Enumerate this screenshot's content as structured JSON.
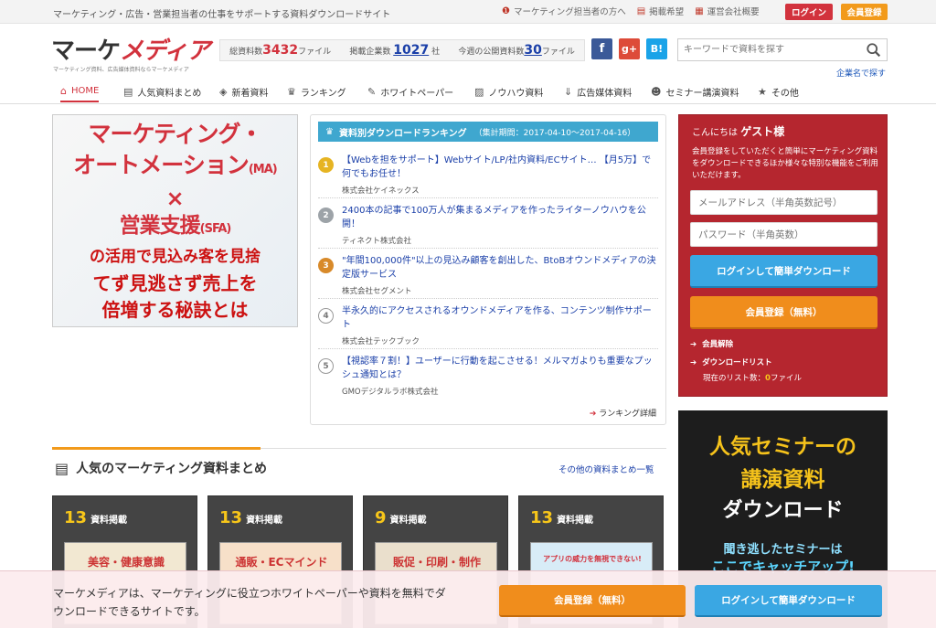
{
  "topbar": {
    "tagline": "マーケティング・広告・営業担当者の仕事をサポートする資料ダウンロードサイト",
    "links": [
      "マーケティング担当者の方へ",
      "掲載希望",
      "運営会社概要"
    ],
    "login": "ログイン",
    "register": "会員登録"
  },
  "header": {
    "logo_plain": "マーケ",
    "logo_em": "メディア",
    "logo_sub": "マーケティング資料、広告媒体資料ならマーケメディア",
    "stats": {
      "total_label": "総資料数",
      "total_value": "3432",
      "total_unit": "ファイル",
      "companies_label": "掲載企業数",
      "companies_value": "1027",
      "companies_unit": "社",
      "weekly_label": "今週の公開資料数",
      "weekly_value": "30",
      "weekly_unit": "ファイル"
    },
    "social": {
      "facebook": "f",
      "google": "g+",
      "hatena": "B!"
    },
    "search_placeholder": "キーワードで資料を探す",
    "company_search": "企業名で探す"
  },
  "nav": [
    "HOME",
    "人気資料まとめ",
    "新着資料",
    "ランキング",
    "ホワイトペーパー",
    "ノウハウ資料",
    "広告媒体資料",
    "セミナー講演資料",
    "その他"
  ],
  "banner": {
    "line1": "マーケティング・",
    "line2": "オートメーション",
    "line2_small": "(MA)",
    "cross": "×",
    "line3": "営業支援",
    "line3_small": "(SFA)",
    "line4": "の活用で見込み客を見捨",
    "line5": "てず見逃さず売上を",
    "line6": "倍増する秘訣とは"
  },
  "ranking": {
    "title": "資料別ダウンロードランキング",
    "period": "（集計期間：2017-04-10〜2017-04-16）",
    "items": [
      {
        "rank": "1",
        "title": "【Webを担をサポート】Webサイト/LP/社内資料/ECサイト… 【月5万】で何でもお任せ！",
        "corp": "株式会社ケイネックス"
      },
      {
        "rank": "2",
        "title": "2400本の記事で100万人が集まるメディアを作ったライターノウハウを公開！",
        "corp": "ティネクト株式会社"
      },
      {
        "rank": "3",
        "title": "\"年間100,000件\"以上の見込み顧客を創出した、BtoBオウンドメディアの決定版サービス",
        "corp": "株式会社セグメント"
      },
      {
        "rank": "4",
        "title": "半永久的にアクセスされるオウンドメディアを作る、コンテンツ制作サポート",
        "corp": "株式会社テックブック"
      },
      {
        "rank": "5",
        "title": "【視認率７割！】ユーザーに行動を起こさせる！メルマガよりも重要なプッシュ通知とは？",
        "corp": "GMOデジタルラボ株式会社"
      }
    ],
    "more": "ランキング詳細"
  },
  "login_box": {
    "hello": "こんにちは",
    "guest": "ゲスト様",
    "desc": "会員登録をしていただくと簡単にマーケティング資料をダウンロードできるほか様々な特別な機能をご利用いただけます。",
    "email_placeholder": "メールアドレス（半角英数記号）",
    "password_placeholder": "パスワード（半角英数）",
    "login_button": "ログインして簡単ダウンロード",
    "register_button": "会員登録（無料）",
    "cancel_link": "会員解除",
    "download_list": "ダウンロードリスト",
    "count_label": "現在のリスト数：",
    "count_value": "0",
    "count_unit": "ファイル"
  },
  "seminar": {
    "line1": "人気セミナーの",
    "line2": "講演資料",
    "line3": "ダウンロード",
    "line4": "聞き逃したセミナーは",
    "line5": "ここでキャッチアップ!"
  },
  "section": {
    "title": "人気のマーケティング資料まとめ",
    "more": "その他の資料まとめ一覧"
  },
  "cards": [
    {
      "count": "13",
      "label": "資料掲載",
      "thumb": "美容・健康意識"
    },
    {
      "count": "13",
      "label": "資料掲載",
      "thumb": "通販・ECマインド"
    },
    {
      "count": "9",
      "label": "資料掲載",
      "thumb": "販促・印刷・制作"
    },
    {
      "count": "13",
      "label": "資料掲載",
      "thumb": "アプリの威力を無視できない!"
    }
  ],
  "overlay": {
    "msg": "マーケメディアは、マーケティングに役立つホワイトペーパーや資料を無料でダウンロードできるサイトです。",
    "register": "会員登録（無料）",
    "login": "ログインして簡単ダウンロード"
  },
  "colors": {
    "brand_red": "#d2323d",
    "orange": "#f08d1c",
    "blue": "#3aa7e3",
    "rank_head": "#3fa7cf"
  }
}
